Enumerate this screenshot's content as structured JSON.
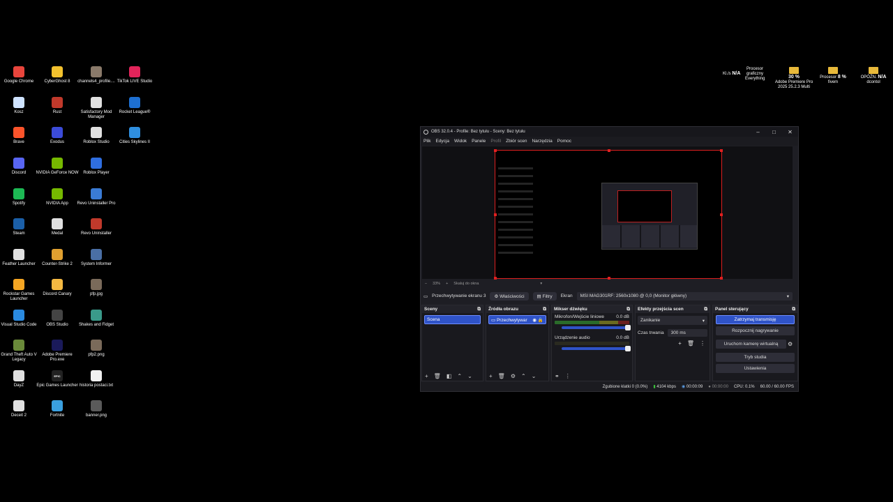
{
  "desktop": {
    "icons": [
      {
        "label": "Google Chrome",
        "color": "#e8453c"
      },
      {
        "label": "CyberGhost 8",
        "color": "#f2c12e"
      },
      {
        "label": "channels4_profile....",
        "color": "#8a7a6a"
      },
      {
        "label": "TikTok LIVE Studio",
        "color": "#e2245a"
      },
      {
        "label": "Kosz",
        "color": "#cfe3ff"
      },
      {
        "label": "Rust",
        "color": "#c0392b"
      },
      {
        "label": "Satisfactory Mod Manager",
        "color": "#e0e0e0"
      },
      {
        "label": "Rocket League®",
        "color": "#1d6fd1"
      },
      {
        "label": "Brave",
        "color": "#fb542b"
      },
      {
        "label": "Exodus",
        "color": "#3b4bd8"
      },
      {
        "label": "Roblox Studio",
        "color": "#e0e0e0"
      },
      {
        "label": "Cities Skylines II",
        "color": "#2f8fe0"
      },
      {
        "label": "Discord",
        "color": "#5865f2"
      },
      {
        "label": "NVIDIA GeForce NOW",
        "color": "#76b900"
      },
      {
        "label": "Roblox Player",
        "color": "#2f6ee0"
      },
      {
        "label": "",
        "color": "#000"
      },
      {
        "label": "Spotify",
        "color": "#1db954"
      },
      {
        "label": "NVIDIA App",
        "color": "#76b900"
      },
      {
        "label": "Revo Uninstaller Pro",
        "color": "#3a7bd5"
      },
      {
        "label": "",
        "color": "#000"
      },
      {
        "label": "Steam",
        "color": "#1b5fa8"
      },
      {
        "label": "Medal",
        "color": "#e0e0e0"
      },
      {
        "label": "Revo Uninstaller",
        "color": "#c0392b"
      },
      {
        "label": "",
        "color": "#000"
      },
      {
        "label": "Feather Launcher",
        "color": "#e0e0e0"
      },
      {
        "label": "Counter-Strike 2",
        "color": "#e0a030"
      },
      {
        "label": "System Informer",
        "color": "#4a6fa5"
      },
      {
        "label": "",
        "color": "#000"
      },
      {
        "label": "Rockstar Games Launcher",
        "color": "#f5a623"
      },
      {
        "label": "Discord Canary",
        "color": "#f5b942"
      },
      {
        "label": "pfp.jpg",
        "color": "#7a6a5a"
      },
      {
        "label": "",
        "color": "#000"
      },
      {
        "label": "Visual Studio Code",
        "color": "#2a8ae0"
      },
      {
        "label": "OBS Studio",
        "color": "#444"
      },
      {
        "label": "Shakes and Fidget",
        "color": "#3a9a8a"
      },
      {
        "label": "",
        "color": "#000"
      },
      {
        "label": "Grand Theft Auto V Legacy",
        "color": "#6a8a3a"
      },
      {
        "label": "Adobe Premiere Pro.exe",
        "color": "#1a1a5a"
      },
      {
        "label": "pfp2.png",
        "color": "#7a6a5a"
      },
      {
        "label": "",
        "color": "#000"
      },
      {
        "label": "DayZ",
        "color": "#e0e0e0"
      },
      {
        "label": "Epic Games Launcher",
        "color": "#222"
      },
      {
        "label": "historia postaci.txt",
        "color": "#f0f0f0"
      },
      {
        "label": "",
        "color": "#000"
      },
      {
        "label": "Deceit 2",
        "color": "#e0e0e0"
      },
      {
        "label": "Fortnite",
        "color": "#3aa0e0"
      },
      {
        "label": "banner.png",
        "color": "#5a5a5a"
      }
    ],
    "icon_glyphs": {
      "Premiere": "Pr",
      "Epic": "EPIC"
    }
  },
  "tray": {
    "kls_label": "Kl./s",
    "kls_value": "N/A",
    "gpu_label": "Procesor graficzny",
    "gpu_sub": "Everything",
    "premiere_value": "30 %",
    "premiere_label": "Adobe Premiere Pro 2025 25.2.3 Multi",
    "cpu_label": "Procesor",
    "cpu_value": "8 %",
    "cpu_sub": "fivem",
    "opozn_label": "OPÓŹN.",
    "opozn_value": "N/A",
    "opozn_sub": "dcontol"
  },
  "obs": {
    "title": "OBS 32.0.4 - Profile: Bez tytułu - Sceny: Bez tytułu",
    "menu": [
      "Plik",
      "Edycja",
      "Widok",
      "Panele",
      "Profil",
      "Zbiór scen",
      "Narzędzia",
      "Pomoc"
    ],
    "zoom_value": "33%",
    "zoom_label": "Skaluj do okna",
    "source_name": "Przechwytywanie ekranu 3",
    "properties_label": "Właściwości",
    "filters_label": "Filtry",
    "screen_label": "Ekran",
    "monitor_value": "MSI MAG301RF: 2560x1080 @ 0,0 (Monitor główny)",
    "docks": {
      "scenes_title": "Sceny",
      "scene_item": "Scena",
      "sources_title": "Źródła obrazu",
      "source_item": "Przechwytywar",
      "mixer_title": "Mikser dźwięku",
      "mixer_ch1": "Mikrofon/Wejście liniowe",
      "mixer_ch1_db": "0.0 dB",
      "mixer_ch2": "Urządzenie audio",
      "mixer_ch2_db": "0.0 dB",
      "transitions_title": "Efekty przejścia scen",
      "transition_value": "Zanikanie",
      "duration_label": "Czas trwania",
      "duration_value": "300 ms",
      "controls_title": "Panel sterujący",
      "btn_stream": "Zatrzymaj transmisję",
      "btn_record": "Rozpocznij nagrywanie",
      "btn_vcam": "Uruchom kamerę wirtualną",
      "btn_studio": "Tryb studia",
      "btn_settings": "Ustawienia"
    },
    "status": {
      "dropped": "Zgubione klatki 0 (0.0%)",
      "bitrate": "4104 kbps",
      "stream_time": "00:00:09",
      "rec_time": "00:00:00",
      "cpu": "CPU: 0.1%",
      "fps": "60.00 / 60.00 FPS"
    }
  }
}
